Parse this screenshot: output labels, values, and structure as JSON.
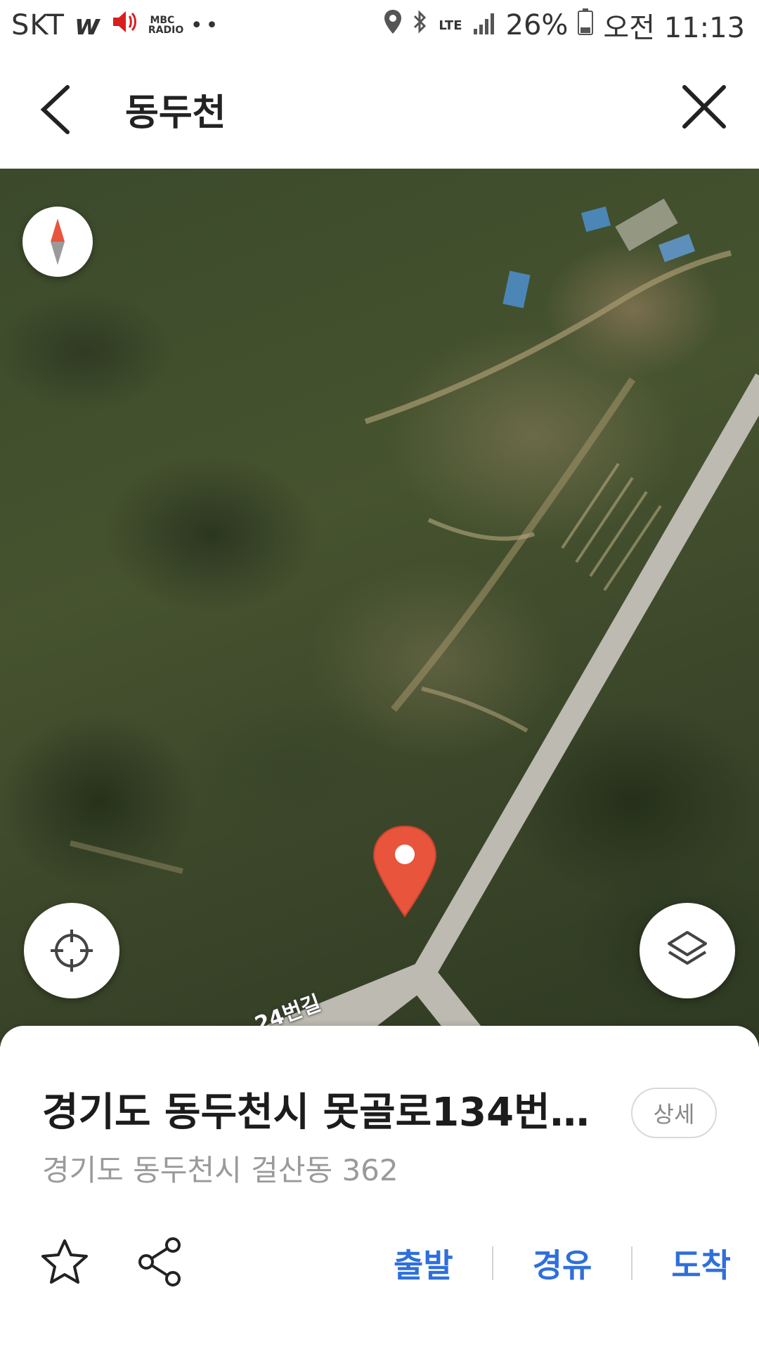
{
  "status_bar": {
    "carrier": "SKT",
    "app_icon_w": "w",
    "radio_label": "MBC RADIO",
    "dots": "••",
    "network": "LTE",
    "battery": "26%",
    "time": "오전 11:13"
  },
  "header": {
    "title": "동두천"
  },
  "map": {
    "road_label": "24번길",
    "pin_color": "#e8543c"
  },
  "place": {
    "title": "경기도 동두천시 못골로134번…",
    "address": "경기도 동두천시 걸산동 362",
    "detail_label": "상세"
  },
  "actions": {
    "depart": "출발",
    "waypoint": "경유",
    "arrive": "도착"
  },
  "colors": {
    "accent": "#2f6fdc"
  }
}
